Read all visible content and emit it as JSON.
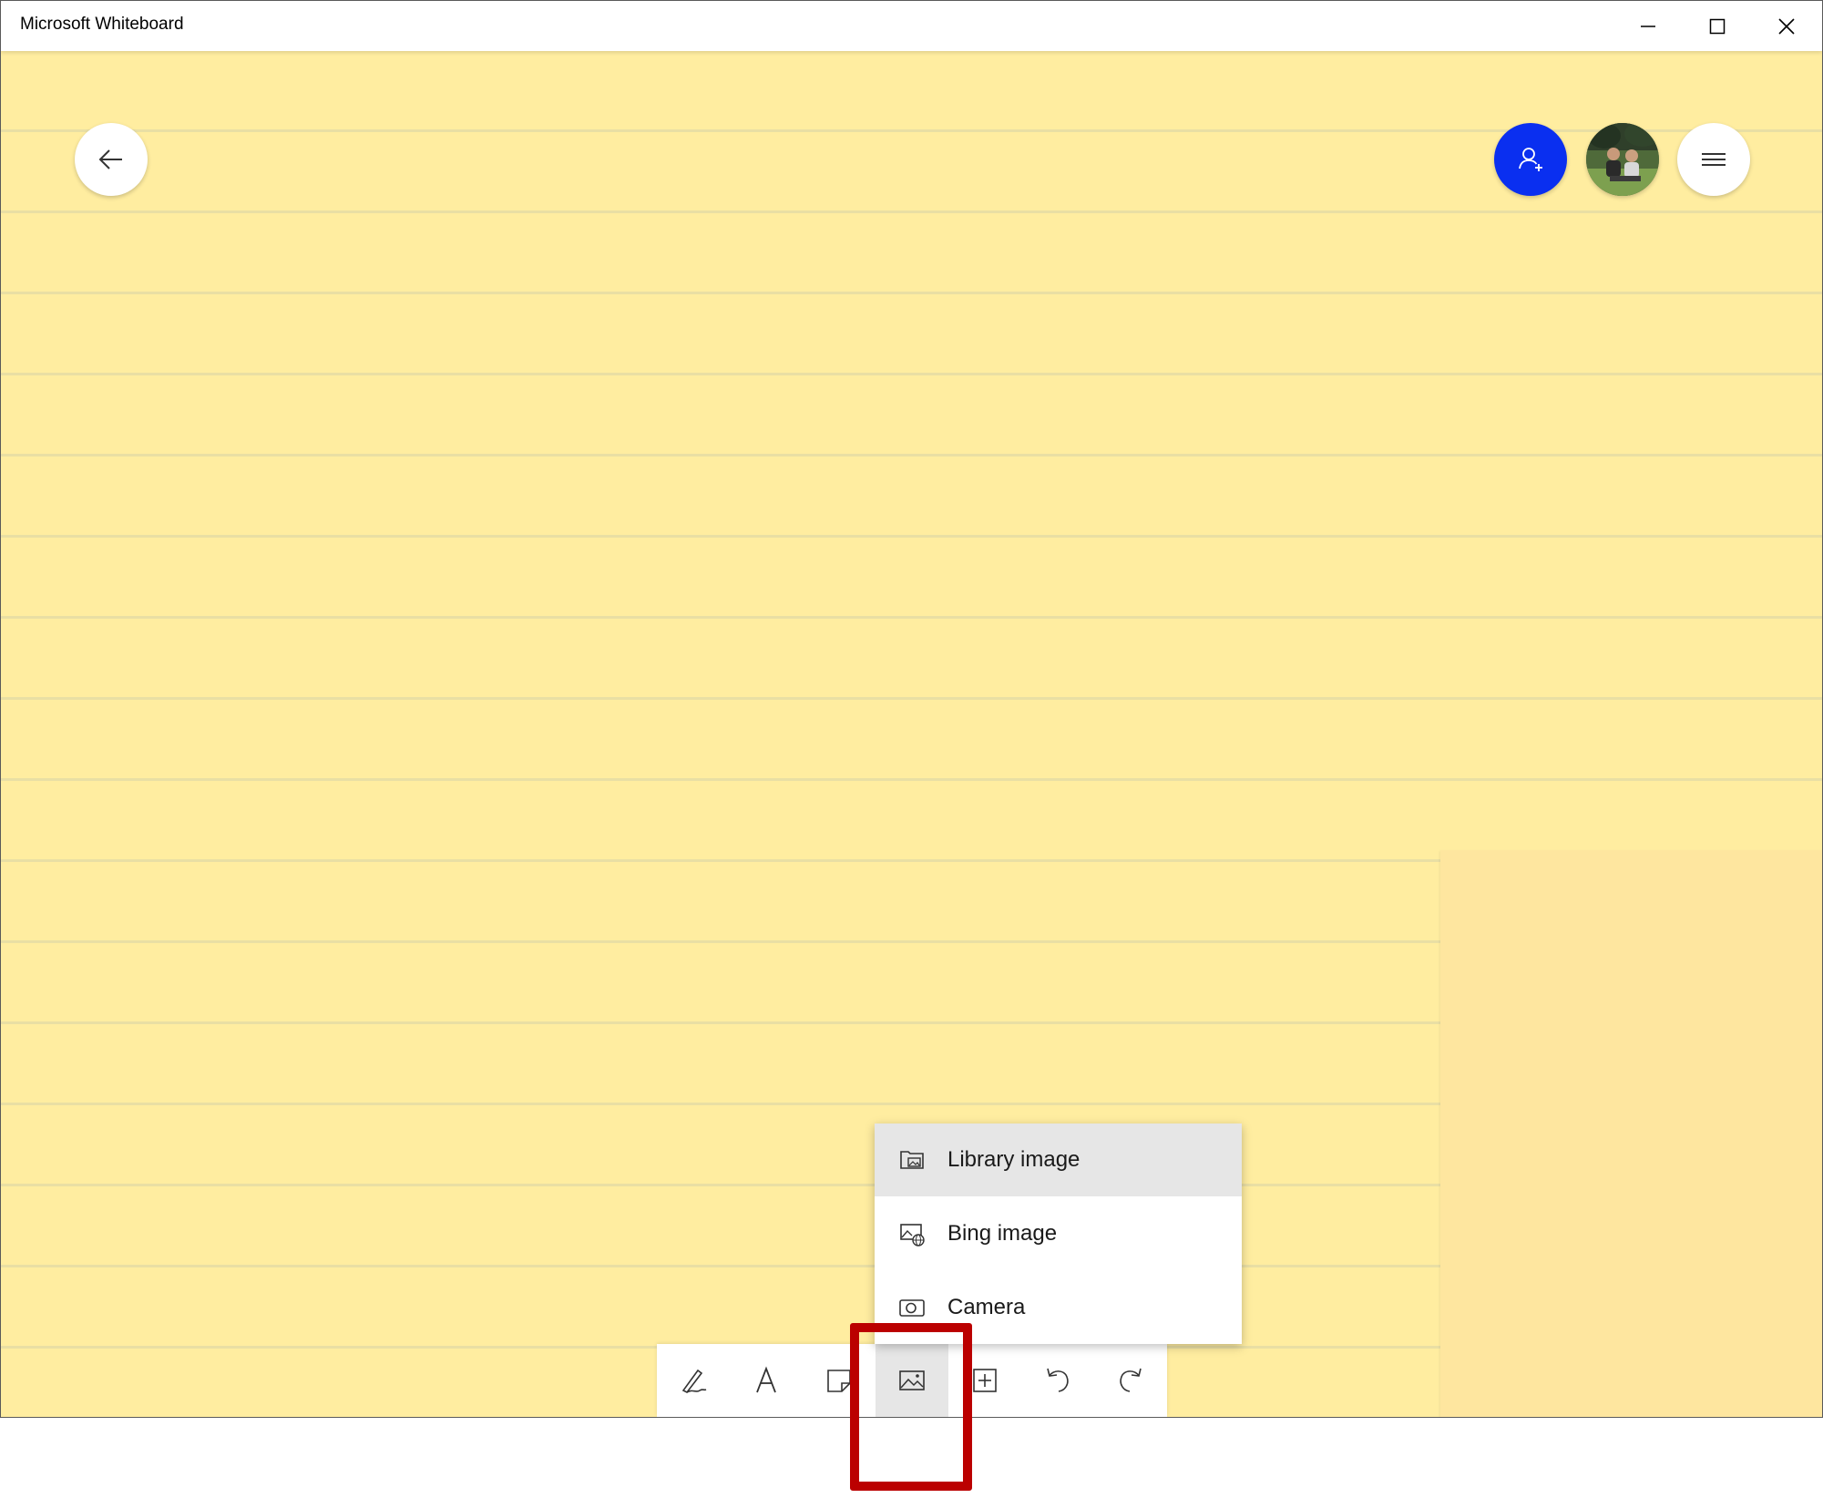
{
  "window": {
    "title": "Microsoft Whiteboard"
  },
  "titlebar_buttons": {
    "minimize_icon": "minimize-icon",
    "maximize_icon": "maximize-icon",
    "close_icon": "close-icon"
  },
  "header": {
    "back_icon": "arrow-left-icon",
    "invite_icon": "person-add-icon",
    "avatar": "user-photo",
    "menu_icon": "hamburger-icon"
  },
  "insert_menu": {
    "items": [
      {
        "label": "Library image",
        "icon": "library-image-icon",
        "highlighted": true
      },
      {
        "label": "Bing image",
        "icon": "bing-image-icon",
        "highlighted": false
      },
      {
        "label": "Camera",
        "icon": "camera-icon",
        "highlighted": false
      }
    ]
  },
  "toolbar": {
    "tools": [
      {
        "name": "pen",
        "icon": "pen-icon"
      },
      {
        "name": "text",
        "icon": "text-icon"
      },
      {
        "name": "note",
        "icon": "note-icon"
      },
      {
        "name": "image",
        "icon": "image-icon",
        "active": true
      },
      {
        "name": "insert",
        "icon": "plus-box-icon"
      },
      {
        "name": "undo",
        "icon": "undo-icon"
      },
      {
        "name": "redo",
        "icon": "redo-icon"
      }
    ]
  },
  "colors": {
    "canvas_background": "#ffeda0",
    "canvas_rule_lines": "#e9dfa4",
    "sticky_note": "#fee69f",
    "invite_button": "#0a2ff0",
    "highlight_frame": "#bb0000",
    "menu_hover": "#e6e6e6"
  }
}
